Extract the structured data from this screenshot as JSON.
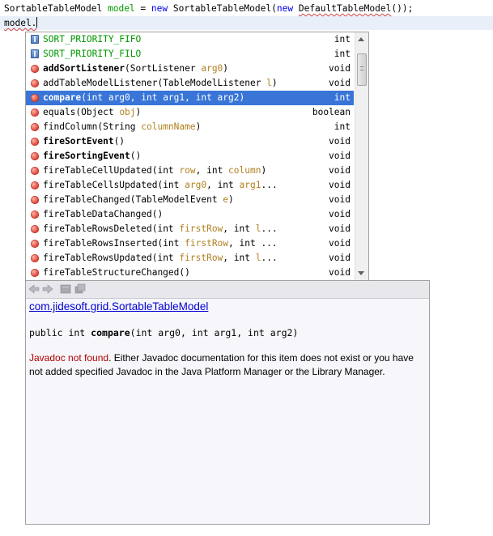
{
  "editor": {
    "line1": {
      "type": "SortableTableModel",
      "var": "model",
      "eq": " = ",
      "kw_new": "new",
      "ctor": "SortableTableModel",
      "open": "(",
      "kw_new2": "new",
      "inner": "DefaultTableModel",
      "close": "());"
    },
    "line2": {
      "text": "model."
    }
  },
  "completion": {
    "selected_index": 4,
    "items": [
      {
        "name": "SORT_PRIORITY_FIFO",
        "params": "",
        "type": "int",
        "icon": "static-field-icon",
        "style": "field"
      },
      {
        "name": "SORT_PRIORITY_FILO",
        "params": "",
        "type": "int",
        "icon": "static-field-icon",
        "style": "field"
      },
      {
        "name": "addSortListener",
        "params": "(SortListener ",
        "pname": "arg0",
        "pend": ")",
        "type": "void",
        "icon": "method-icon",
        "style": "bold"
      },
      {
        "name": "addTableModelListener",
        "params": "(TableModelListener ",
        "pname": "l",
        "pend": ")",
        "type": "void",
        "icon": "method-icon",
        "style": "normal"
      },
      {
        "name": "compare",
        "params": "(int arg0, int arg1, int arg2)",
        "type": "int",
        "icon": "method-icon",
        "style": "bold"
      },
      {
        "name": "equals",
        "params": "(Object ",
        "pname": "obj",
        "pend": ")",
        "type": "boolean",
        "icon": "method-icon",
        "style": "normal"
      },
      {
        "name": "findColumn",
        "params": "(String ",
        "pname": "columnName",
        "pend": ")",
        "type": "int",
        "icon": "method-icon",
        "style": "normal"
      },
      {
        "name": "fireSortEvent",
        "params": "()",
        "type": "void",
        "icon": "method-icon",
        "style": "bold"
      },
      {
        "name": "fireSortingEvent",
        "params": "()",
        "type": "void",
        "icon": "method-icon",
        "style": "bold"
      },
      {
        "name": "fireTableCellUpdated",
        "params": "(int ",
        "pname": "row",
        "pmid": ", int ",
        "pname2": "column",
        "pend": ")",
        "type": "void",
        "icon": "method-icon",
        "style": "normal"
      },
      {
        "name": "fireTableCellsUpdated",
        "params": "(int ",
        "pname": "arg0",
        "pmid": ", int ",
        "pname2": "arg1",
        "pend": "...",
        "type": "void",
        "icon": "method-icon",
        "style": "normal"
      },
      {
        "name": "fireTableChanged",
        "params": "(TableModelEvent ",
        "pname": "e",
        "pend": ")",
        "type": "void",
        "icon": "method-icon",
        "style": "normal"
      },
      {
        "name": "fireTableDataChanged",
        "params": "()",
        "type": "void",
        "icon": "method-icon",
        "style": "normal"
      },
      {
        "name": "fireTableRowsDeleted",
        "params": "(int ",
        "pname": "firstRow",
        "pmid": ", int ",
        "pname2": "l",
        "pend": "...",
        "type": "void",
        "icon": "method-icon",
        "style": "normal"
      },
      {
        "name": "fireTableRowsInserted",
        "params": "(int ",
        "pname": "firstRow",
        "pend": ", int ...",
        "type": "void",
        "icon": "method-icon",
        "style": "normal"
      },
      {
        "name": "fireTableRowsUpdated",
        "params": "(int ",
        "pname": "firstRow",
        "pmid": ", int ",
        "pname2": "l",
        "pend": "...",
        "type": "void",
        "icon": "method-icon",
        "style": "normal"
      },
      {
        "name": "fireTableStructureChanged",
        "params": "()",
        "type": "void",
        "icon": "method-icon",
        "style": "normal"
      }
    ]
  },
  "javadoc": {
    "class_link": "com.jidesoft.grid.SortableTableModel",
    "signature": {
      "prefix": "public int ",
      "method": "compare",
      "args": "(int arg0, int arg1, int arg2)"
    },
    "not_found": "Javadoc not found",
    "message": ". Either Javadoc documentation for this item does not exist or you have not added specified Javadoc in the Java Platform Manager or the Library Manager."
  },
  "colors": {
    "keyword": "#0000e6",
    "field": "#009900",
    "parameter": "#b08020",
    "selection": "#3875d7",
    "error": "#b00000",
    "link": "#0000d0"
  }
}
